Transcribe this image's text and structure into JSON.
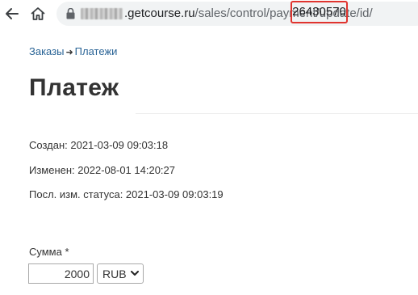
{
  "browser": {
    "url_host": ".getcourse.ru",
    "url_path": "/sales/control/payment/update/id/",
    "url_id": "26430570"
  },
  "breadcrumb": {
    "orders": "Заказы",
    "arrow": "➜",
    "payments": "Платежи"
  },
  "page": {
    "title": "Платеж"
  },
  "meta": {
    "created": "Создан: 2021-03-09 09:03:18",
    "modified": "Изменен: 2022-08-01 14:20:27",
    "status_changed": "Посл. изм. статуса: 2021-03-09 09:03:19"
  },
  "form": {
    "amount_label": "Сумма *",
    "amount_value": "2000",
    "currency_value": "RUB"
  },
  "colors": {
    "highlight_box": "#e0342f",
    "link": "#2a6496"
  }
}
